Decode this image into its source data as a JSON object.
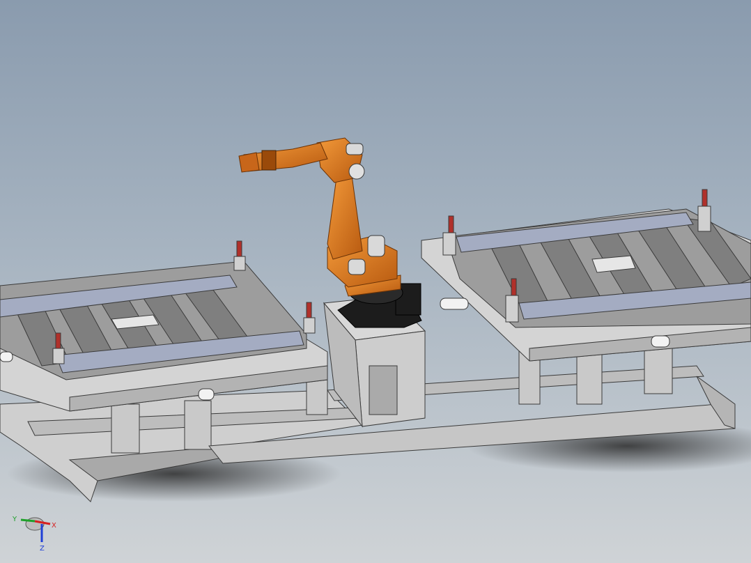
{
  "viewport": {
    "background_top": "#8a9bae",
    "background_bottom": "#cfd3d6"
  },
  "model": {
    "robot_color": "#e07a1e",
    "robot_dark": "#a8520c",
    "base_color": "#1c1c1c",
    "frame_color": "#cfcfcf",
    "frame_dark": "#8f8f8f",
    "fixture_blue": "#a4acc2",
    "clamp_red": "#b0302a"
  },
  "triad": {
    "x_label": "X",
    "y_label": "Y",
    "z_label": "Z",
    "x_color": "#d62020",
    "y_color": "#1ea02a",
    "z_color": "#1f3fd6"
  }
}
